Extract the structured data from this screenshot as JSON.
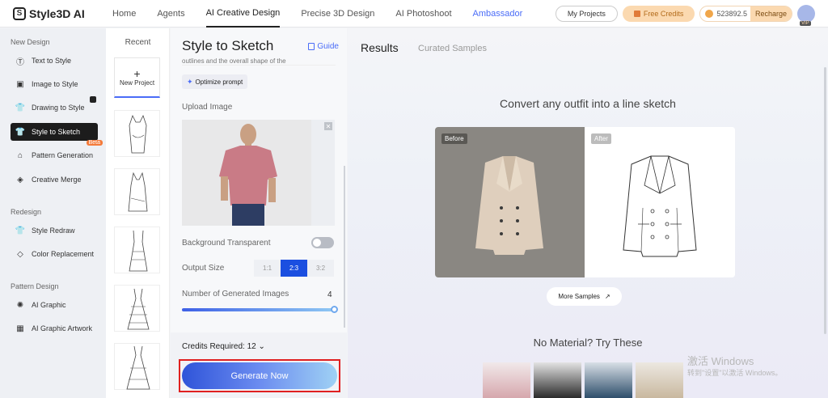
{
  "brand": {
    "name": "Style3D AI"
  },
  "nav": {
    "items": [
      "Home",
      "Agents",
      "AI Creative Design",
      "Precise 3D Design",
      "AI Photoshoot",
      "Ambassador"
    ],
    "active": "AI Creative Design"
  },
  "topbar": {
    "my_projects": "My Projects",
    "free_credits": "Free Credits",
    "balance": "523892.5",
    "recharge": "Recharge",
    "vip": "VIP"
  },
  "sidebar": {
    "new_design_title": "New Design",
    "new_design": [
      "Text to Style",
      "Image to Style",
      "Drawing to Style",
      "Style to Sketch",
      "Pattern Generation",
      "Creative Merge"
    ],
    "beta": "Beta",
    "redesign_title": "Redesign",
    "redesign": [
      "Style Redraw",
      "Color Replacement"
    ],
    "pattern_title": "Pattern Design",
    "pattern": [
      "AI Graphic",
      "AI Graphic Artwork"
    ]
  },
  "recent": {
    "title": "Recent",
    "new_project": "New Project"
  },
  "panel": {
    "title": "Style to Sketch",
    "guide": "Guide",
    "prompt_tail": "outlines and the overall shape of the",
    "optimize": "Optimize prompt",
    "upload_label": "Upload Image",
    "bg_transparent": "Background Transparent",
    "output_size": "Output Size",
    "sizes": [
      "1:1",
      "2:3",
      "3:2"
    ],
    "size_selected": "2:3",
    "num_images_label": "Number of Generated Images",
    "num_images": "4",
    "num_images_fraction": 1.0,
    "credits_required": "Credits Required: 12",
    "generate": "Generate Now"
  },
  "results": {
    "tab_results": "Results",
    "tab_curated": "Curated Samples",
    "heading": "Convert any outfit into a line sketch",
    "before": "Before",
    "after": "After",
    "more_samples": "More Samples",
    "no_material": "No Material? Try These"
  },
  "watermark": {
    "line1": "激活 Windows",
    "line2": "转到\"设置\"以激活 Windows。"
  }
}
